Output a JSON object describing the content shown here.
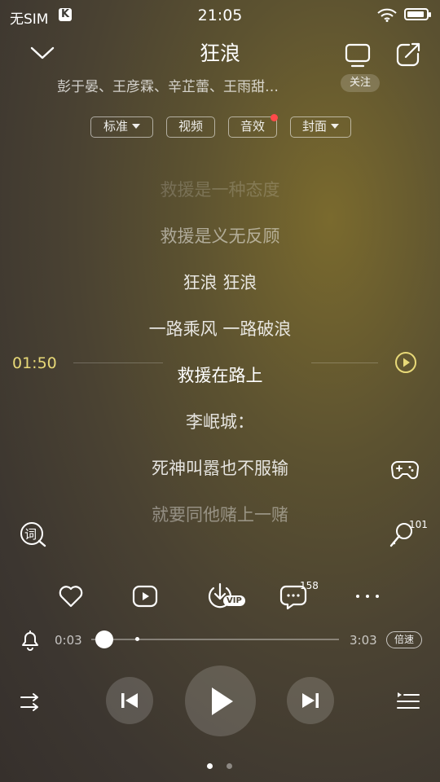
{
  "status_bar": {
    "carrier": "无SIM",
    "app_badge": "K",
    "time": "21:05"
  },
  "header": {
    "song_title": "狂浪",
    "artists": "彭于晏、王彦霖、辛芷蕾、王雨甜…",
    "follow_label": "关注"
  },
  "options": {
    "quality": "标准",
    "video": "视频",
    "effects": "音效",
    "cover": "封面"
  },
  "lyrics": {
    "lines": [
      "救援是一种态度",
      "救援是义无反顾",
      "狂浪 狂浪",
      "一路乘风 一路破浪",
      "救援在路上",
      "李岷城：",
      "死神叫嚣也不服输",
      "就要同他赌上一赌"
    ],
    "seek_time": "01:50"
  },
  "side": {
    "lyric_icon_label": "词",
    "karaoke_count": "101"
  },
  "actions": {
    "download_badge": "VIP",
    "comment_count": "158"
  },
  "playback": {
    "elapsed": "0:03",
    "duration": "3:03",
    "progress": 0.017,
    "speed_label": "倍速"
  },
  "pager": {
    "count": 2,
    "active": 0
  },
  "colors": {
    "accent": "#e8d978",
    "red_dot": "#ff4a4a"
  }
}
